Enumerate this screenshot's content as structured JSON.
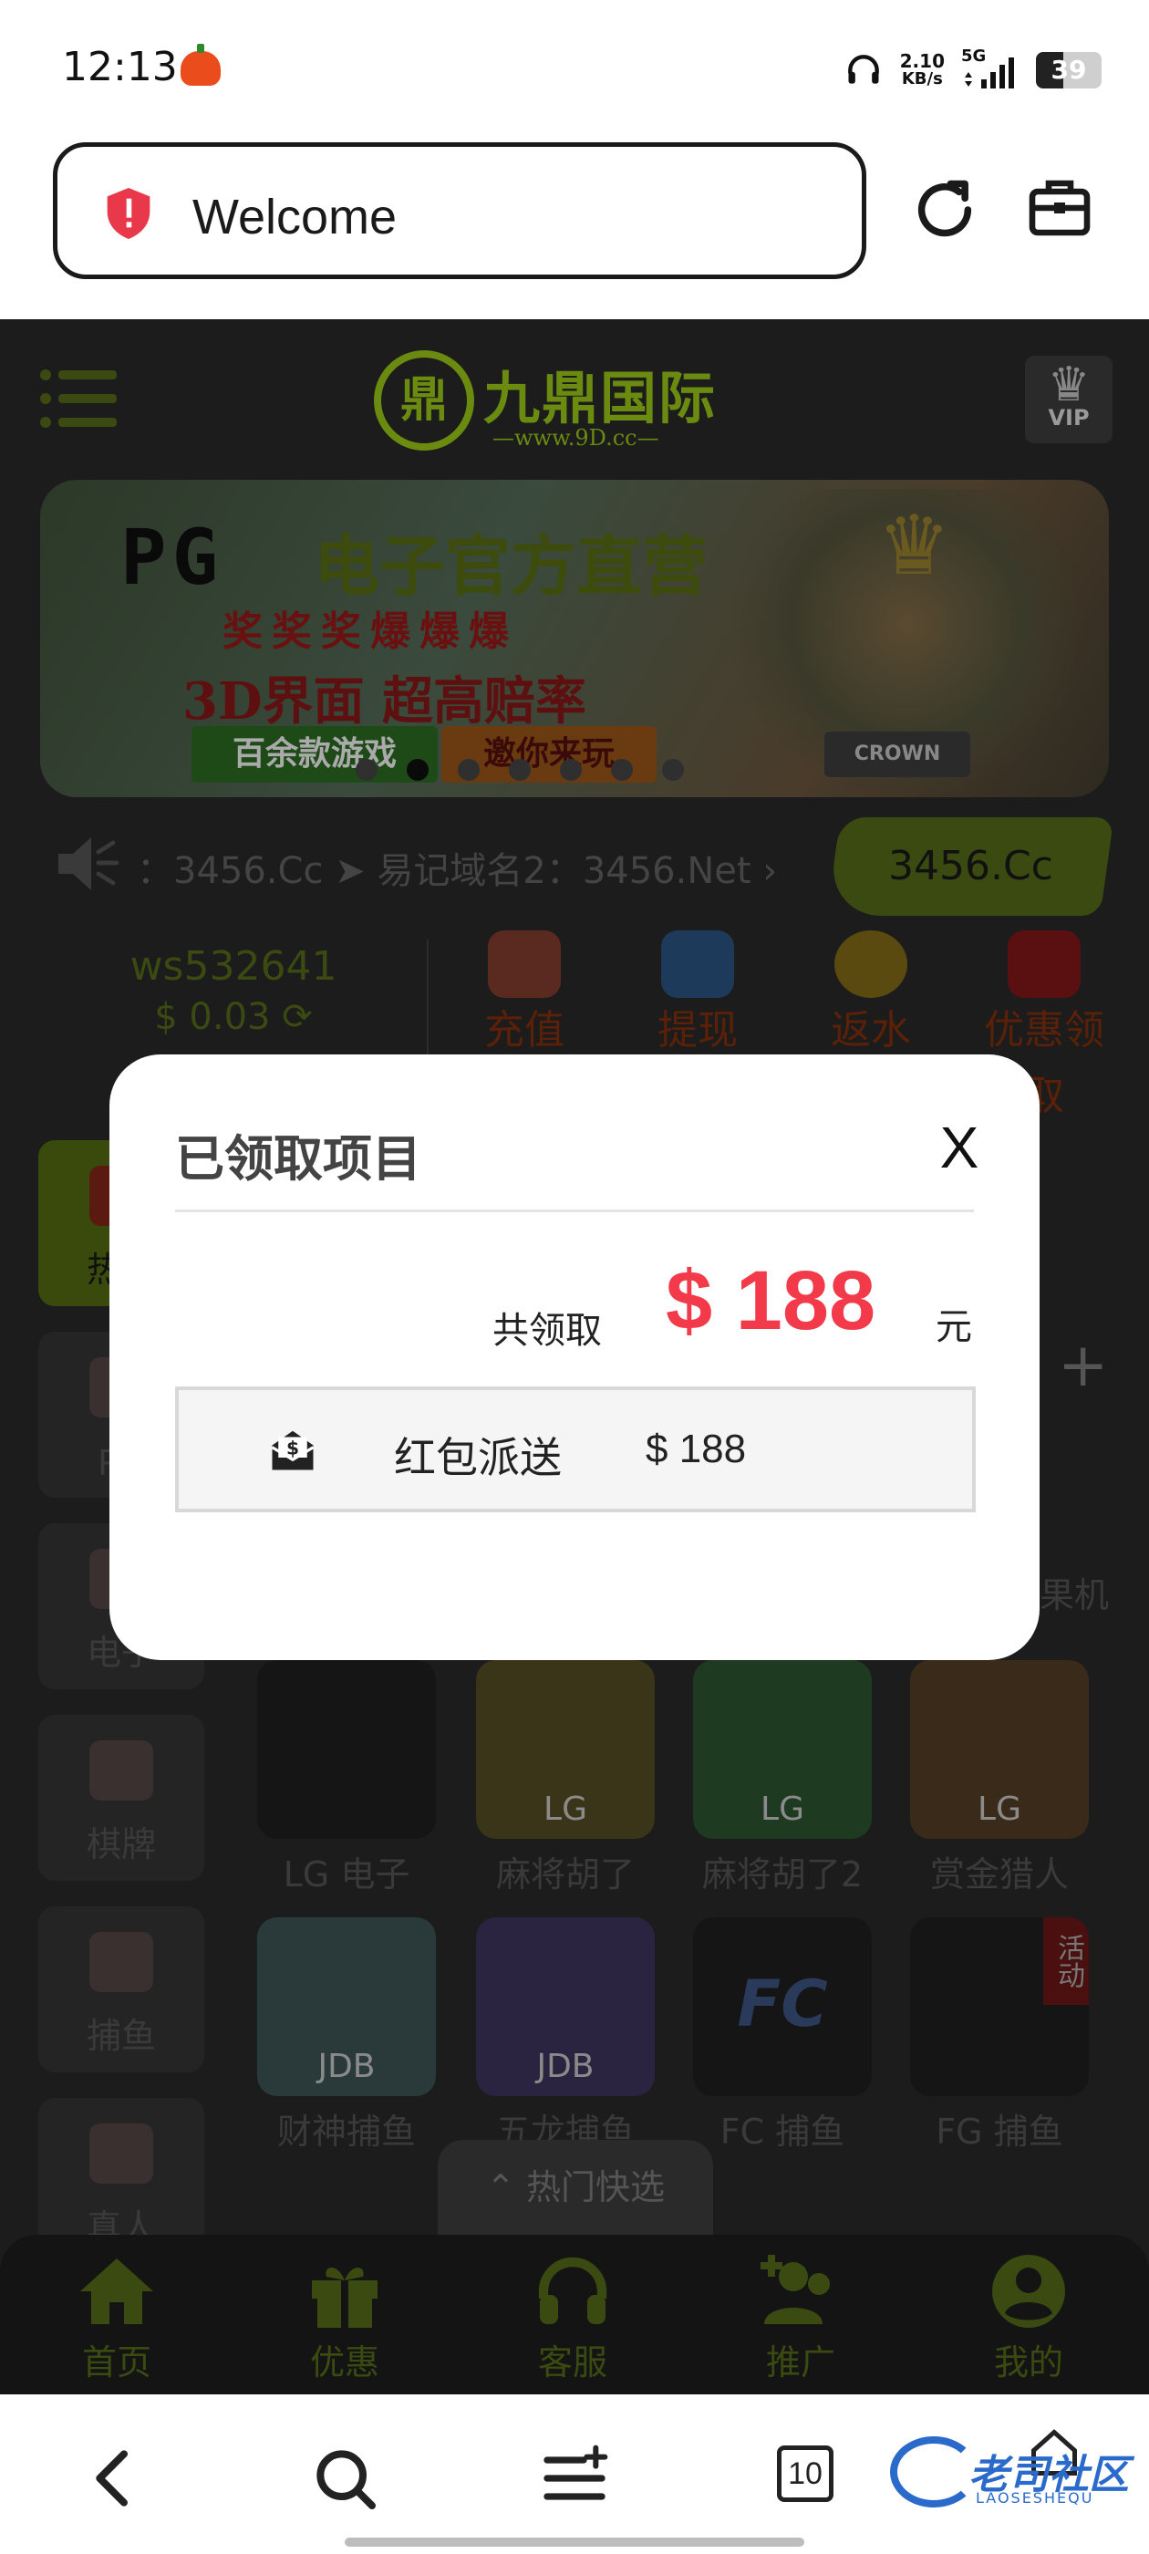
{
  "status_bar": {
    "time": "12:13",
    "net_speed": "2.10",
    "net_unit": "KB/s",
    "network": "5G",
    "battery": "39"
  },
  "browser": {
    "url_text": "Welcome",
    "tab_count": "10"
  },
  "site": {
    "logo_title": "九鼎国际",
    "logo_sub": "—www.9D.cc—",
    "vip_label": "VIP",
    "banner": {
      "brand": "PG",
      "headline": "电子官方直营",
      "row2": "奖奖奖爆爆爆",
      "headline2": "3D界面 超高赔率",
      "pill_left": "百余款游戏",
      "pill_right": "邀你来玩",
      "badge": "CROWN"
    },
    "marquee": "：3456.Cc ➤ 易记域名2：3456.Net ›",
    "domain_button": "3456.Cc",
    "account": {
      "username": "ws532641",
      "balance": "$ 0.03"
    },
    "quick_actions": [
      {
        "label": "充值",
        "color": "#5a2a20"
      },
      {
        "label": "提现",
        "color": "#1e3a5a"
      },
      {
        "label": "返水",
        "color": "#5a4a10"
      },
      {
        "label": "优惠领取",
        "color": "#5a1010"
      }
    ],
    "categories": [
      {
        "label": "热门",
        "active": true
      },
      {
        "label": "PG",
        "active": false
      },
      {
        "label": "电子",
        "active": false
      },
      {
        "label": "棋牌",
        "active": false
      },
      {
        "label": "捕鱼",
        "active": false
      },
      {
        "label": "真人",
        "active": false
      }
    ],
    "games_row1": [
      {
        "label": "LG 电子",
        "tag": ""
      },
      {
        "label": "麻将胡了",
        "tag": "LG"
      },
      {
        "label": "麻将胡了2",
        "tag": "LG"
      },
      {
        "label": "赏金猎人",
        "tag": "LG"
      }
    ],
    "games_row2": [
      {
        "label": "财神捕鱼",
        "tag": "JDB"
      },
      {
        "label": "五龙捕鱼",
        "tag": "JDB"
      },
      {
        "label": "FC 捕鱼",
        "tag": ""
      },
      {
        "label": "FG 捕鱼",
        "tag": "活动"
      }
    ],
    "partial_label": "果机",
    "hot_fast": "热门快选",
    "nav": [
      "首页",
      "优惠",
      "客服",
      "推广",
      "我的"
    ]
  },
  "modal": {
    "title": "已领取项目",
    "close": "X",
    "total_prefix": "共领取",
    "total_amount": "$ 188",
    "total_suffix": "元",
    "item_name": "红包派送",
    "item_amount": "$ 188"
  },
  "watermark": {
    "text": "老司社区",
    "sub": "LAOSESHEQU"
  },
  "colors": {
    "accent_red": "#f23a4a",
    "site_green": "#3a4a10"
  }
}
